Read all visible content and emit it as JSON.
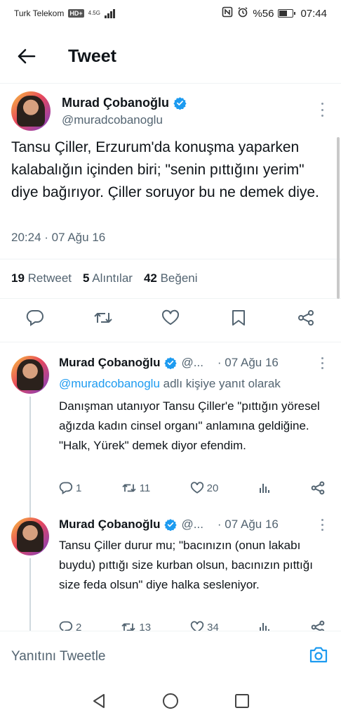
{
  "status_bar": {
    "carrier": "Turk Telekom",
    "hd_badge": "HD+",
    "network": "4.5G",
    "battery_percent": "%56",
    "time": "07:44",
    "battery_level": 0.56
  },
  "header": {
    "title": "Tweet",
    "back_icon": "arrow-left-icon"
  },
  "main_tweet": {
    "author_name": "Murad Çobanoğlu",
    "author_handle": "@muradcobanoglu",
    "text": "Tansu Çiller, Erzurum'da konuşma yaparken kalabalığın içinden biri; \"senin pıttığını yerim\" diye bağırıyor. Çiller soruyor bu ne demek diye.",
    "timestamp": "20:24 · 07 Ağu 16",
    "stats": {
      "retweets": "19",
      "retweets_label": "Retweet",
      "quotes": "5",
      "quotes_label": "Alıntılar",
      "likes": "42",
      "likes_label": "Beğeni"
    }
  },
  "replies": [
    {
      "author_name": "Murad Çobanoğlu",
      "author_handle": "@...",
      "time": "· 07 Ağu 16",
      "replying_to_mention": "@muradcobanoglu",
      "replying_to_suffix": "adlı kişiye yanıt olarak",
      "text": "Danışman utanıyor Tansu Çiller'e \"pıttığın yöresel ağızda kadın cinsel organı\" anlamına geldiğine. \"Halk, Yürek\" demek diyor efendim.",
      "replies": "1",
      "retweets": "11",
      "likes": "20"
    },
    {
      "author_name": "Murad Çobanoğlu",
      "author_handle": "@...",
      "time": "· 07 Ağu 16",
      "text": "Tansu Çiller durur mu; \"bacınızın (onun lakabı buydu) pıttığı size kurban olsun, bacınızın pıttığı size feda olsun\" diye halka sesleniyor.",
      "replies": "2",
      "retweets": "13",
      "likes": "34"
    }
  ],
  "compose": {
    "placeholder": "Yanıtını Tweetle"
  },
  "colors": {
    "accent": "#1d9bf0",
    "text_primary": "#0f1419",
    "text_secondary": "#536471",
    "separator": "#eff3f4"
  }
}
